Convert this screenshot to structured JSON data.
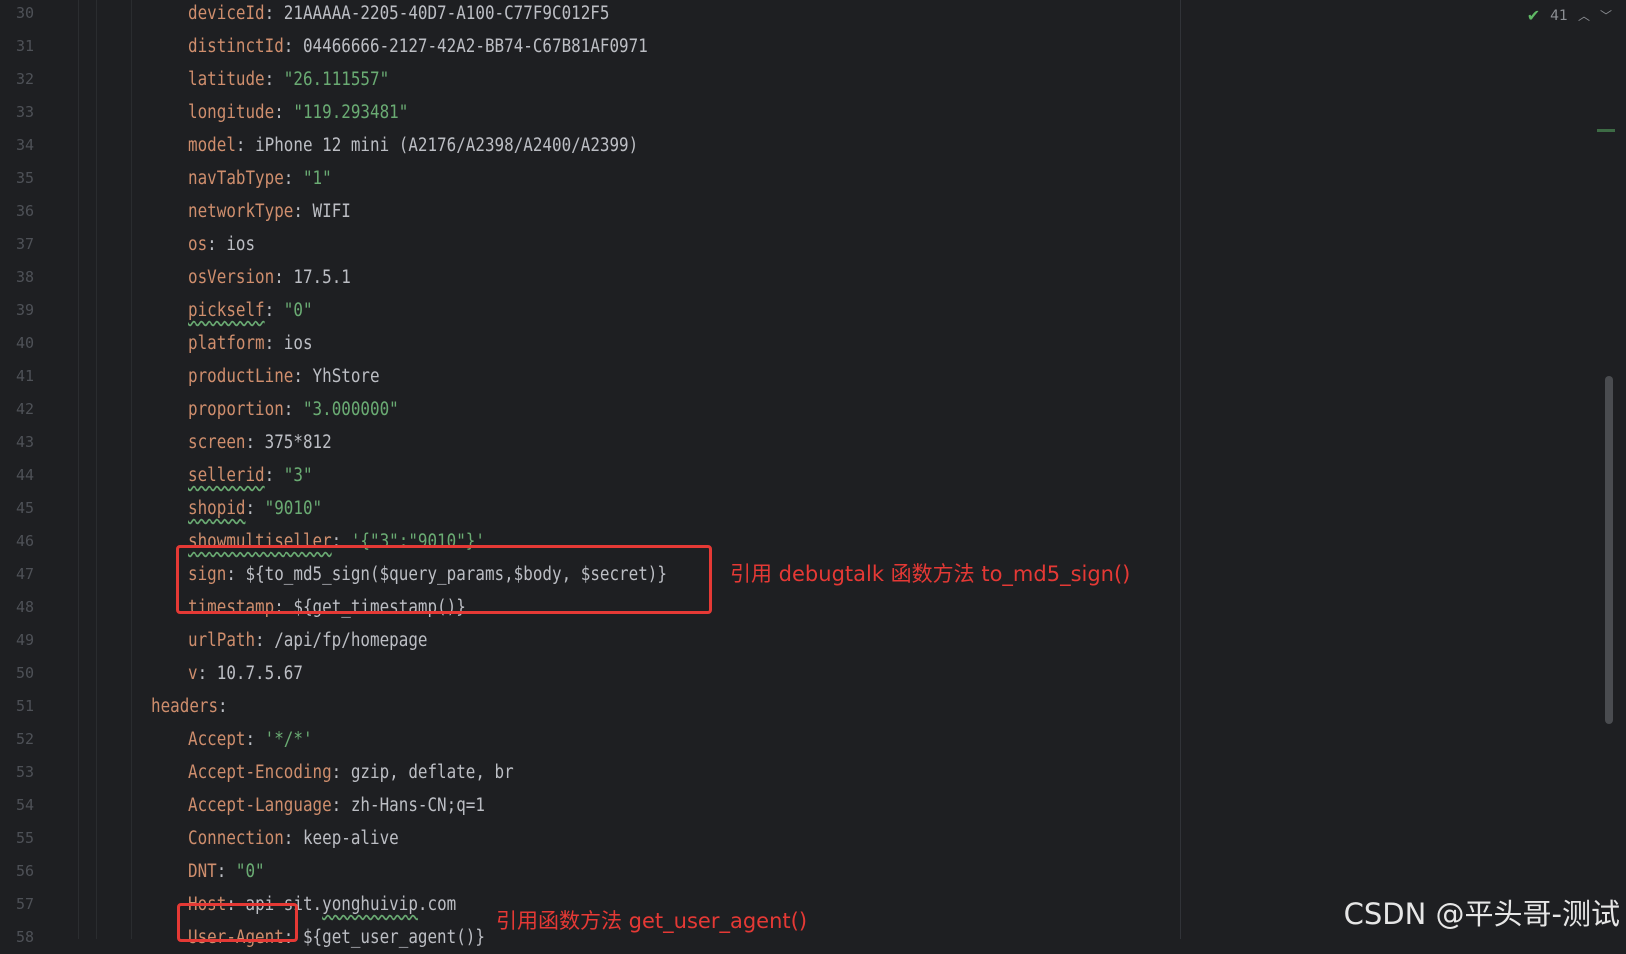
{
  "editor": {
    "inspection_count": "41",
    "lines": [
      {
        "n": "30",
        "indent": 2,
        "parts": [
          {
            "t": "deviceId",
            "c": "key"
          },
          {
            "t": ": ",
            "c": "plain"
          },
          {
            "t": "21AAAAA-2205-40D7-A100-C77F9C012F5",
            "c": "plain"
          }
        ]
      },
      {
        "n": "31",
        "indent": 2,
        "parts": [
          {
            "t": "distinctId",
            "c": "key"
          },
          {
            "t": ": ",
            "c": "plain"
          },
          {
            "t": "04466666-2127-42A2-BB74-C67B81AF0971",
            "c": "plain"
          }
        ]
      },
      {
        "n": "32",
        "indent": 2,
        "parts": [
          {
            "t": "latitude",
            "c": "key"
          },
          {
            "t": ": ",
            "c": "plain"
          },
          {
            "t": "\"26.111557\"",
            "c": "str"
          }
        ]
      },
      {
        "n": "33",
        "indent": 2,
        "parts": [
          {
            "t": "longitude",
            "c": "key"
          },
          {
            "t": ": ",
            "c": "plain"
          },
          {
            "t": "\"119.293481\"",
            "c": "str"
          }
        ]
      },
      {
        "n": "34",
        "indent": 2,
        "parts": [
          {
            "t": "model",
            "c": "key"
          },
          {
            "t": ": ",
            "c": "plain"
          },
          {
            "t": "iPhone 12 mini (A2176/A2398/A2400/A2399)",
            "c": "plain"
          }
        ]
      },
      {
        "n": "35",
        "indent": 2,
        "parts": [
          {
            "t": "navTabType",
            "c": "key"
          },
          {
            "t": ": ",
            "c": "plain"
          },
          {
            "t": "\"1\"",
            "c": "str"
          }
        ]
      },
      {
        "n": "36",
        "indent": 2,
        "parts": [
          {
            "t": "networkType",
            "c": "key"
          },
          {
            "t": ": ",
            "c": "plain"
          },
          {
            "t": "WIFI",
            "c": "plain"
          }
        ]
      },
      {
        "n": "37",
        "indent": 2,
        "parts": [
          {
            "t": "os",
            "c": "key"
          },
          {
            "t": ": ",
            "c": "plain"
          },
          {
            "t": "ios",
            "c": "plain"
          }
        ]
      },
      {
        "n": "38",
        "indent": 2,
        "parts": [
          {
            "t": "osVersion",
            "c": "key"
          },
          {
            "t": ": ",
            "c": "plain"
          },
          {
            "t": "17.5.1",
            "c": "plain"
          }
        ]
      },
      {
        "n": "39",
        "indent": 2,
        "parts": [
          {
            "t": "pickself",
            "c": "key squig"
          },
          {
            "t": ": ",
            "c": "plain"
          },
          {
            "t": "\"0\"",
            "c": "str"
          }
        ]
      },
      {
        "n": "40",
        "indent": 2,
        "parts": [
          {
            "t": "platform",
            "c": "key"
          },
          {
            "t": ": ",
            "c": "plain"
          },
          {
            "t": "ios",
            "c": "plain"
          }
        ]
      },
      {
        "n": "41",
        "indent": 2,
        "parts": [
          {
            "t": "productLine",
            "c": "key"
          },
          {
            "t": ": ",
            "c": "plain"
          },
          {
            "t": "YhStore",
            "c": "plain"
          }
        ]
      },
      {
        "n": "42",
        "indent": 2,
        "parts": [
          {
            "t": "proportion",
            "c": "key"
          },
          {
            "t": ": ",
            "c": "plain"
          },
          {
            "t": "\"3.000000\"",
            "c": "str"
          }
        ]
      },
      {
        "n": "43",
        "indent": 2,
        "parts": [
          {
            "t": "screen",
            "c": "key"
          },
          {
            "t": ": ",
            "c": "plain"
          },
          {
            "t": "375*812",
            "c": "plain"
          }
        ]
      },
      {
        "n": "44",
        "indent": 2,
        "parts": [
          {
            "t": "sellerid",
            "c": "key squig"
          },
          {
            "t": ": ",
            "c": "plain"
          },
          {
            "t": "\"3\"",
            "c": "str"
          }
        ]
      },
      {
        "n": "45",
        "indent": 2,
        "parts": [
          {
            "t": "shopid",
            "c": "key squig"
          },
          {
            "t": ": ",
            "c": "plain"
          },
          {
            "t": "\"9010\"",
            "c": "str"
          }
        ]
      },
      {
        "n": "46",
        "indent": 2,
        "parts": [
          {
            "t": "showmultiseller",
            "c": "key squig"
          },
          {
            "t": ": ",
            "c": "plain"
          },
          {
            "t": "'{\"3\":\"9010\"}'",
            "c": "str"
          }
        ]
      },
      {
        "n": "47",
        "indent": 2,
        "parts": [
          {
            "t": "sign",
            "c": "key"
          },
          {
            "t": ": ",
            "c": "plain"
          },
          {
            "t": "${to_md5_sign($query_params,$body, $secret)}",
            "c": "plain"
          }
        ]
      },
      {
        "n": "48",
        "indent": 2,
        "parts": [
          {
            "t": "timestamp",
            "c": "key"
          },
          {
            "t": ": ",
            "c": "plain"
          },
          {
            "t": "${get_timestamp()}",
            "c": "plain"
          }
        ]
      },
      {
        "n": "49",
        "indent": 2,
        "parts": [
          {
            "t": "urlPath",
            "c": "key"
          },
          {
            "t": ": ",
            "c": "plain"
          },
          {
            "t": "/api/fp/homepage",
            "c": "plain"
          }
        ]
      },
      {
        "n": "50",
        "indent": 2,
        "parts": [
          {
            "t": "v",
            "c": "key"
          },
          {
            "t": ": ",
            "c": "plain"
          },
          {
            "t": "10.7.5.67",
            "c": "plain"
          }
        ]
      },
      {
        "n": "51",
        "indent": 1,
        "parts": [
          {
            "t": "headers",
            "c": "key"
          },
          {
            "t": ":",
            "c": "plain"
          }
        ]
      },
      {
        "n": "52",
        "indent": 2,
        "parts": [
          {
            "t": "Accept",
            "c": "key"
          },
          {
            "t": ": ",
            "c": "plain"
          },
          {
            "t": "'*/*'",
            "c": "str"
          }
        ]
      },
      {
        "n": "53",
        "indent": 2,
        "parts": [
          {
            "t": "Accept-Encoding",
            "c": "key"
          },
          {
            "t": ": ",
            "c": "plain"
          },
          {
            "t": "gzip, deflate, br",
            "c": "plain"
          }
        ]
      },
      {
        "n": "54",
        "indent": 2,
        "parts": [
          {
            "t": "Accept-Language",
            "c": "key"
          },
          {
            "t": ": ",
            "c": "plain"
          },
          {
            "t": "zh-Hans-CN;q=1",
            "c": "plain"
          }
        ]
      },
      {
        "n": "55",
        "indent": 2,
        "parts": [
          {
            "t": "Connection",
            "c": "key"
          },
          {
            "t": ": ",
            "c": "plain"
          },
          {
            "t": "keep-alive",
            "c": "plain"
          }
        ]
      },
      {
        "n": "56",
        "indent": 2,
        "parts": [
          {
            "t": "DNT",
            "c": "key"
          },
          {
            "t": ": ",
            "c": "plain"
          },
          {
            "t": "\"0\"",
            "c": "str"
          }
        ]
      },
      {
        "n": "57",
        "indent": 2,
        "parts": [
          {
            "t": "Host",
            "c": "key"
          },
          {
            "t": ": ",
            "c": "plain"
          },
          {
            "t": "api-sit.",
            "c": "plain"
          },
          {
            "t": "yonghuivip",
            "c": "plain squig"
          },
          {
            "t": ".com",
            "c": "plain"
          }
        ]
      },
      {
        "n": "58",
        "indent": 2,
        "parts": [
          {
            "t": "User-Agent",
            "c": "key"
          },
          {
            "t": ": ",
            "c": "plain"
          },
          {
            "t": "${get_user_agent()}",
            "c": "plain"
          }
        ]
      }
    ]
  },
  "annotations": {
    "sign_note": "引用 debugtalk 函数方法 to_md5_sign()",
    "user_agent_note": "引用函数方法 get_user_agent()"
  },
  "watermark": "CSDN @平头哥-测试",
  "colors": {
    "background": "#1e1f22",
    "key": "#cf8e6d",
    "string": "#6aab73",
    "text": "#bcbec4",
    "annotation": "#e53935"
  }
}
